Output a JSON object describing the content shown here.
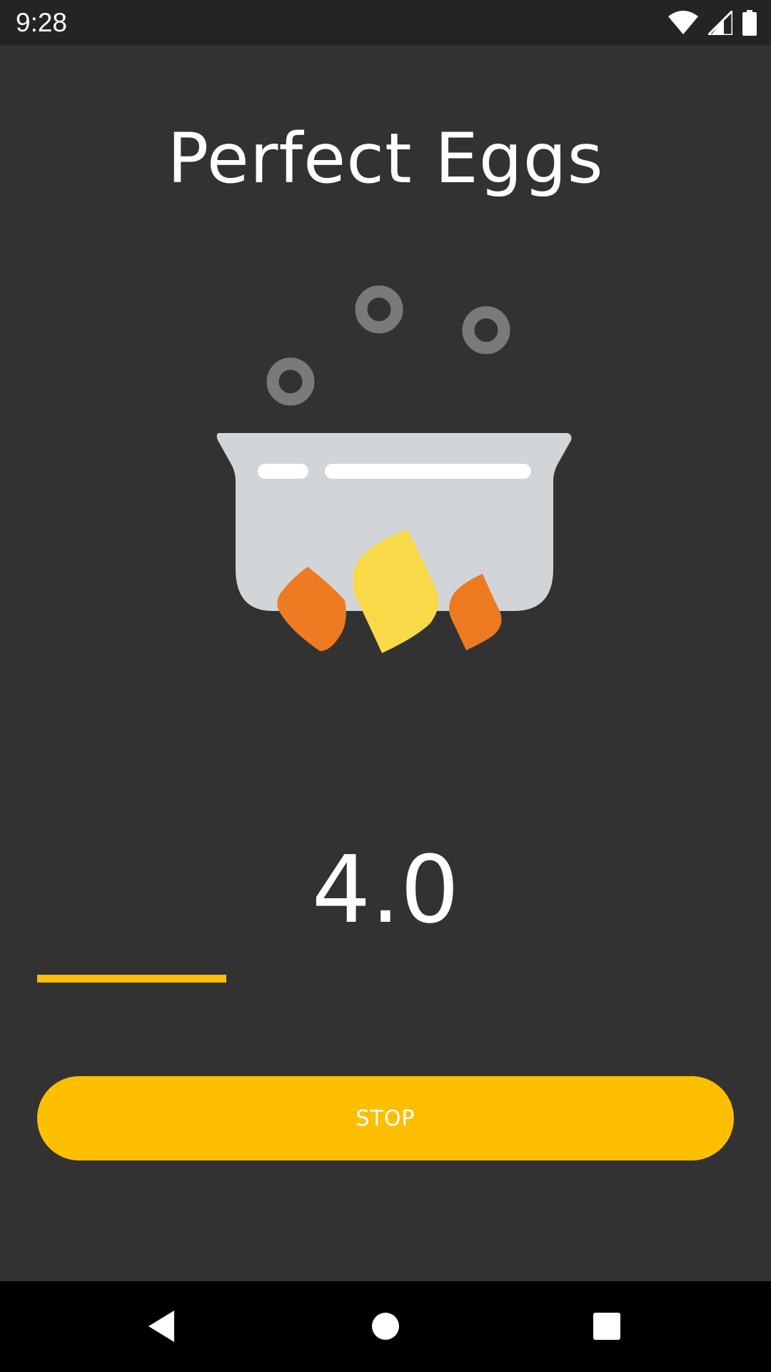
{
  "status_bar": {
    "time": "9:28",
    "icons": [
      "wifi-icon",
      "signal-icon",
      "battery-icon"
    ]
  },
  "app": {
    "title": "Perfect Eggs"
  },
  "illustration": {
    "name": "boiling-pot-over-fire",
    "colors": {
      "pot": "#d2d5d8",
      "steam": "#7a7a7a",
      "flame_outer": "#ee7a22",
      "flame_center": "#f8da48"
    }
  },
  "timer": {
    "value": "4.0",
    "progress_fraction": 0.272
  },
  "actions": {
    "stop_label": "STOP"
  },
  "colors": {
    "background": "#323232",
    "accent": "#fdbf00",
    "status_bar": "#242424",
    "nav_bar": "#000000"
  },
  "nav_bar": {
    "buttons": [
      "back-icon",
      "home-icon",
      "recents-icon"
    ]
  }
}
